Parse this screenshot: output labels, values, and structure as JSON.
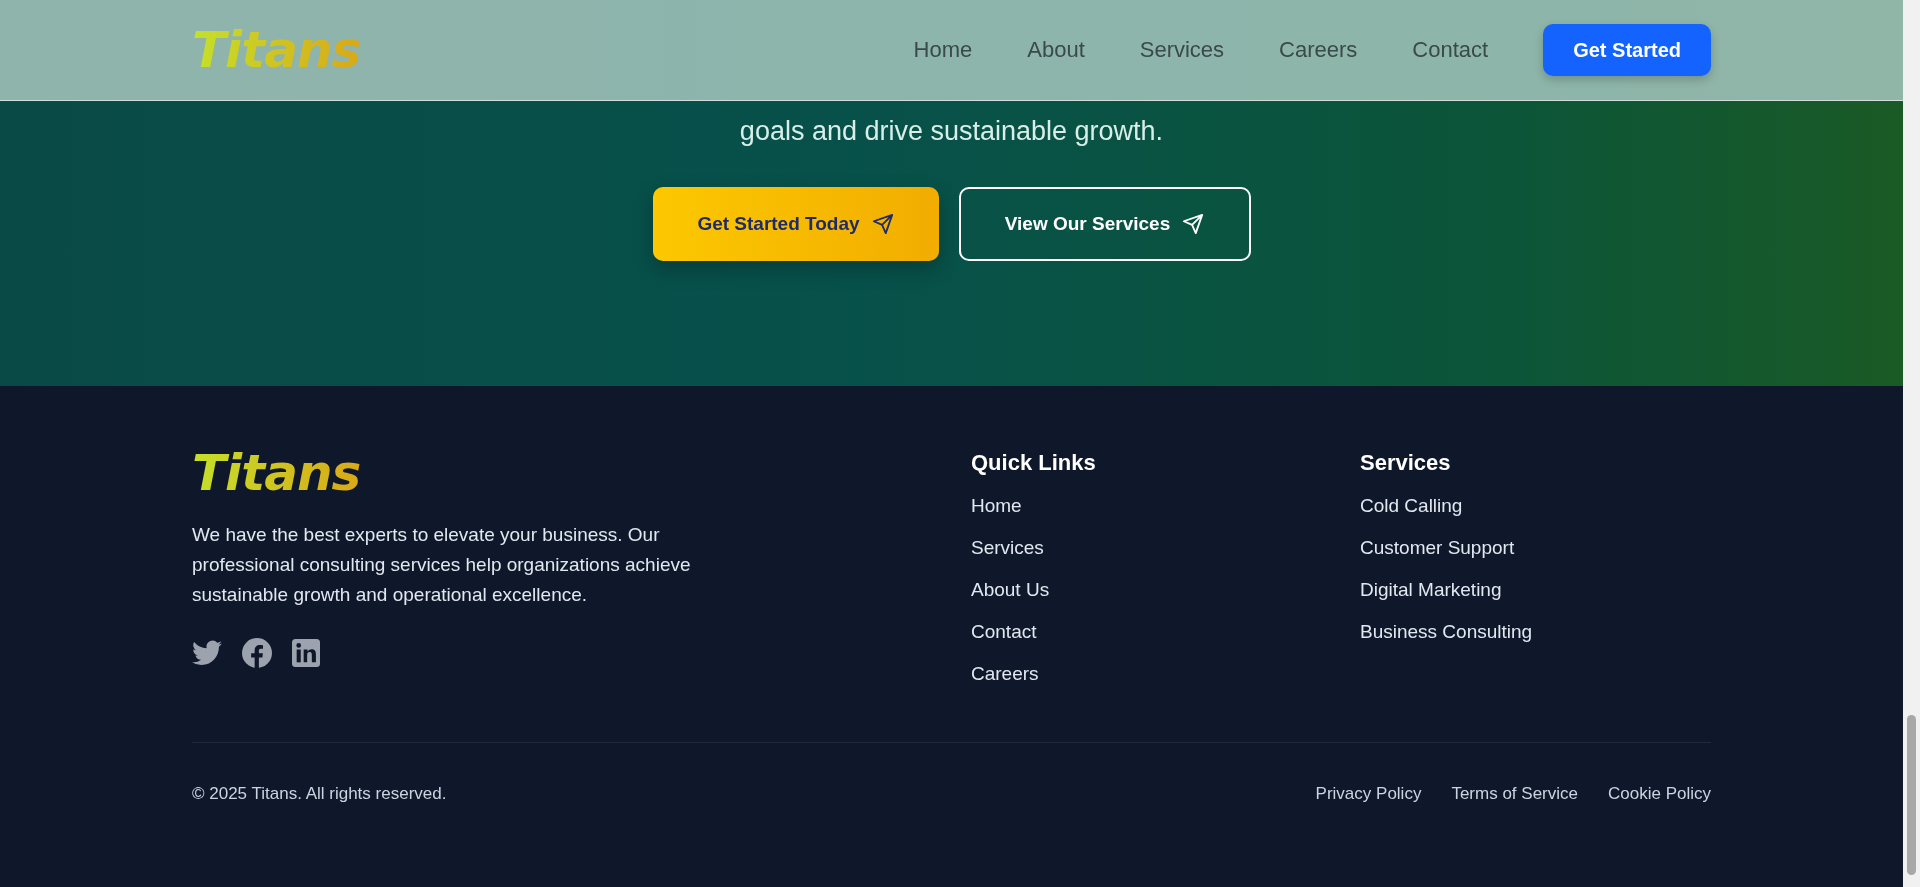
{
  "header": {
    "logo": "Titans",
    "nav": [
      "Home",
      "About",
      "Services",
      "Careers",
      "Contact"
    ],
    "cta": "Get Started"
  },
  "hero": {
    "text": "goals and drive sustainable growth.",
    "buttons": [
      {
        "label": "Get Started Today",
        "kind": "primary"
      },
      {
        "label": "View Our Services",
        "kind": "outline"
      }
    ]
  },
  "footer": {
    "logo": "Titans",
    "description": "We have the best experts to elevate your business. Our professional consulting services help organizations achieve sustainable growth and operational excellence.",
    "columns": [
      {
        "title": "Quick Links",
        "links": [
          "Home",
          "Services",
          "About Us",
          "Contact",
          "Careers"
        ]
      },
      {
        "title": "Services",
        "links": [
          "Cold Calling",
          "Customer Support",
          "Digital Marketing",
          "Business Consulting"
        ]
      }
    ],
    "copyright": "© 2025 Titans. All rights reserved.",
    "legal": [
      "Privacy Policy",
      "Terms of Service",
      "Cookie Policy"
    ]
  }
}
